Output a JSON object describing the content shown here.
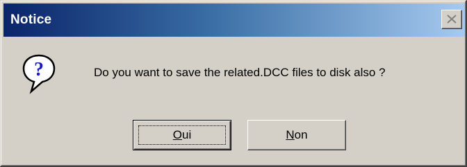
{
  "window": {
    "title": "Notice"
  },
  "dialog": {
    "icon": "question-icon",
    "message": "Do you want to save the related.DCC files to disk also ?"
  },
  "buttons": {
    "yes": {
      "mnemonic": "O",
      "rest": "ui",
      "label": "Oui"
    },
    "no": {
      "mnemonic": "N",
      "rest": "on",
      "label": "Non"
    }
  },
  "colors": {
    "titlebar_start": "#0a246a",
    "titlebar_end": "#a6caf0",
    "face": "#d4d0c8",
    "icon_fill": "#1a1acc"
  }
}
